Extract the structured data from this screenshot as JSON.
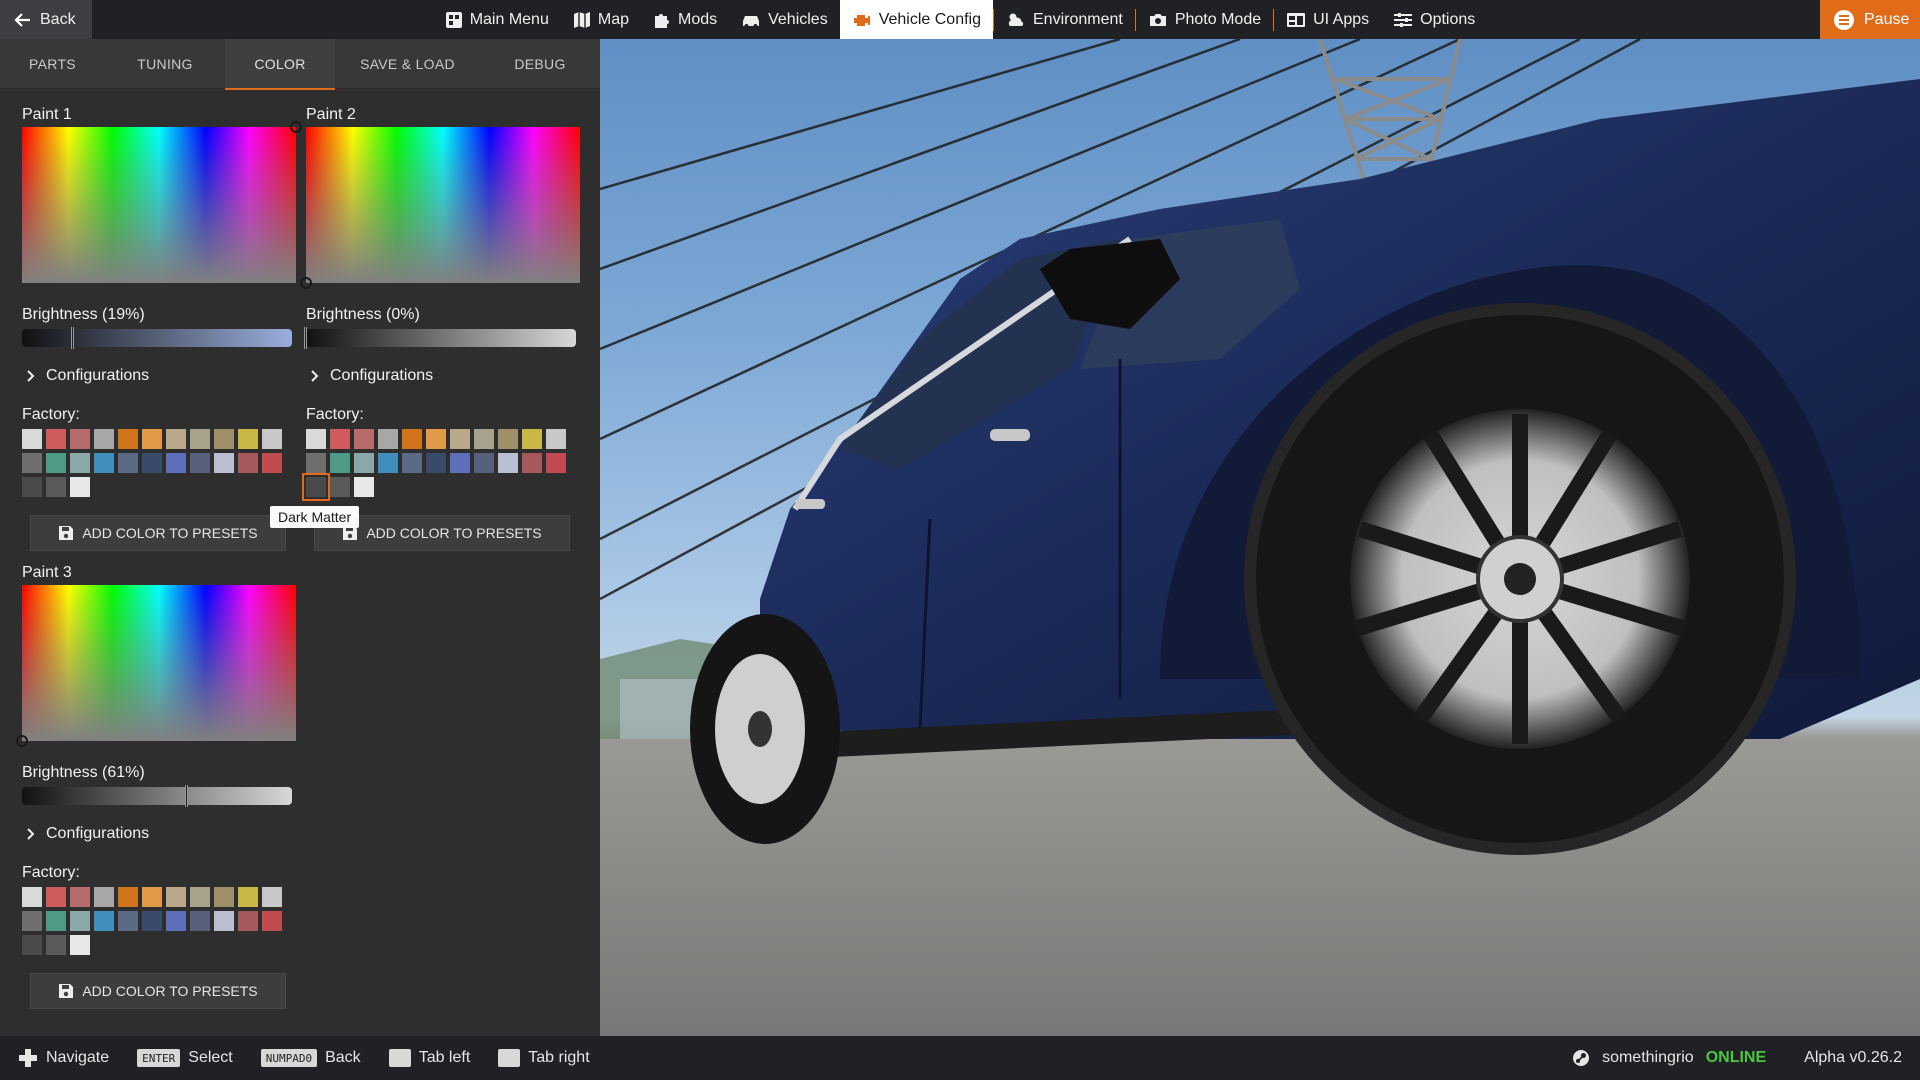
{
  "topbar": {
    "back_label": "Back",
    "pause_label": "Pause",
    "nav": [
      {
        "label": "Main Menu",
        "icon": "main-menu-icon"
      },
      {
        "label": "Map",
        "icon": "map-icon"
      },
      {
        "label": "Mods",
        "icon": "puzzle-icon"
      },
      {
        "label": "Vehicles",
        "icon": "car-icon"
      },
      {
        "label": "Vehicle Config",
        "icon": "engine-icon",
        "active": true
      },
      {
        "label": "Environment",
        "icon": "weather-icon"
      },
      {
        "label": "Photo Mode",
        "icon": "camera-icon"
      },
      {
        "label": "UI Apps",
        "icon": "ui-apps-icon"
      },
      {
        "label": "Options",
        "icon": "sliders-icon"
      }
    ]
  },
  "tabs": [
    {
      "label": "PARTS"
    },
    {
      "label": "TUNING"
    },
    {
      "label": "COLOR",
      "active": true
    },
    {
      "label": "SAVE & LOAD"
    },
    {
      "label": "DEBUG"
    }
  ],
  "paints": {
    "p1": {
      "title": "Paint 1",
      "brightness_label": "Brightness (19%)",
      "brightness": 0.19,
      "picker_hue": 1.0,
      "picker_saturation": 1.0,
      "slider_color": "#9aaede",
      "configurations_label": "Configurations",
      "factory_label": "Factory:",
      "add_label": "ADD COLOR TO PRESETS"
    },
    "p2": {
      "title": "Paint 2",
      "brightness_label": "Brightness (0%)",
      "brightness": 0.0,
      "picker_hue": 0.0,
      "picker_saturation": 0.0,
      "slider_color": "#d8d8d8",
      "configurations_label": "Configurations",
      "factory_label": "Factory:",
      "add_label": "ADD COLOR TO PRESETS",
      "tooltip": "Dark Matter"
    },
    "p3": {
      "title": "Paint 3",
      "brightness_label": "Brightness (61%)",
      "brightness": 0.61,
      "picker_hue": 0.0,
      "picker_saturation": 0.0,
      "slider_color": "#d8d8d8",
      "configurations_label": "Configurations",
      "factory_label": "Factory:",
      "add_label": "ADD COLOR TO PRESETS"
    }
  },
  "factory_colors": [
    "#d9d9d9",
    "#cf5b5b",
    "#b86b6b",
    "#a7a7a7",
    "#d0741c",
    "#e19a45",
    "#b9a88a",
    "#a8a28a",
    "#9f9167",
    "#c9b843",
    "#c8c8c8",
    "#6f6f6f",
    "#4d9a86",
    "#8aa8a8",
    "#3e8fbd",
    "#5b6b86",
    "#3a4a6a",
    "#5d6fb8",
    "#56607a",
    "#b9bfd1",
    "#a7585c",
    "#c24b52",
    "#4a4a4a",
    "#5a5a5a",
    "#e8e8e8"
  ],
  "selected_factory_index_p2": 22,
  "bottombar": {
    "hints": [
      {
        "key": "",
        "label": "Navigate",
        "icon": "dpad-icon"
      },
      {
        "key": "ENTER",
        "label": "Select"
      },
      {
        "key": "NUMPAD0",
        "label": "Back"
      },
      {
        "key": "",
        "label": "Tab left"
      },
      {
        "key": "",
        "label": "Tab right"
      }
    ],
    "username": "somethingrio",
    "status": "ONLINE",
    "version": "Alpha v0.26.2"
  },
  "colors": {
    "accent": "#e06c1a",
    "online": "#4cc642"
  }
}
